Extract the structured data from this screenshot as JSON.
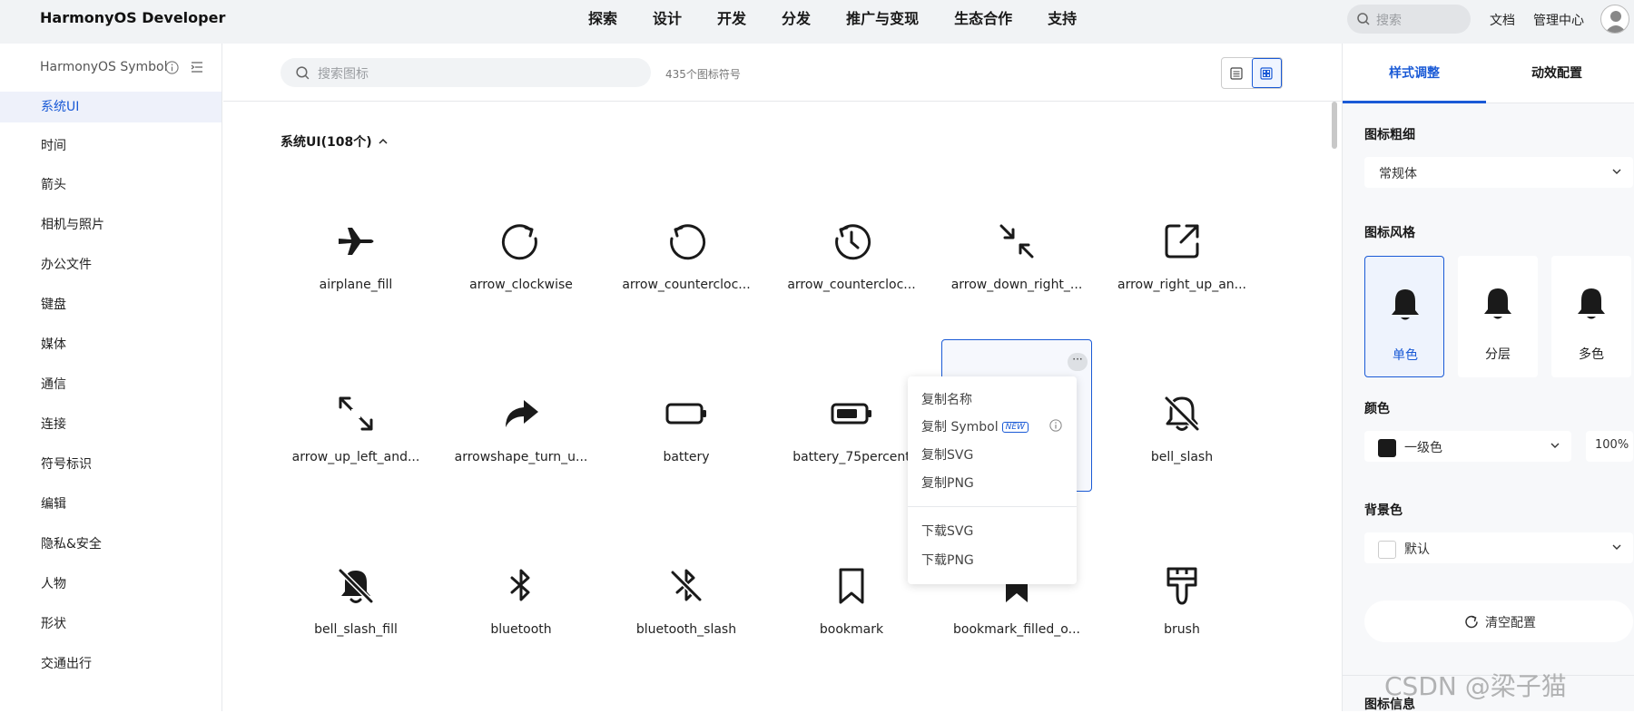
{
  "topbar": {
    "logo": "HarmonyOS Developer",
    "nav": [
      "探索",
      "设计",
      "开发",
      "分发",
      "推广与变现",
      "生态合作",
      "支持"
    ],
    "search_placeholder": "搜索",
    "docs_link": "文档",
    "admin_link": "管理中心"
  },
  "sidebar": {
    "title": "HarmonyOS Symbol",
    "items": [
      "系统UI",
      "时间",
      "箭头",
      "相机与照片",
      "办公文件",
      "键盘",
      "媒体",
      "通信",
      "连接",
      "符号标识",
      "编辑",
      "隐私&安全",
      "人物",
      "形状",
      "交通出行"
    ],
    "active_index": 0
  },
  "main": {
    "search_placeholder": "搜索图标",
    "count_text": "435个图标符号",
    "category_header": "系统UI(108个)",
    "icons": [
      "airplane_fill",
      "arrow_clockwise",
      "arrow_countercloc...",
      "arrow_countercloc...",
      "arrow_down_right_...",
      "arrow_right_up_an...",
      "arrow_up_left_and...",
      "arrowshape_turn_u...",
      "battery",
      "battery_75percent",
      "",
      "bell_slash",
      "bell_slash_fill",
      "bluetooth",
      "bluetooth_slash",
      "bookmark",
      "bookmark_filled_o...",
      "brush"
    ],
    "icon_names": [
      "airplane-icon",
      "arrow-clockwise-icon",
      "arrow-counterclockwise-icon",
      "clock-counterclockwise-icon",
      "arrow-down-right-icon",
      "arrow-right-up-icon",
      "arrow-up-left-icon",
      "arrowshape-turn-up-icon",
      "battery-icon",
      "battery-75-icon",
      "bell-icon",
      "bell-slash-icon",
      "bell-slash-fill-icon",
      "bluetooth-icon",
      "bluetooth-slash-icon",
      "bookmark-icon",
      "bookmark-filled-icon",
      "brush-icon"
    ],
    "hover_index": 10,
    "more_label": "···"
  },
  "context_menu": {
    "copy_name": "复制名称",
    "copy_symbol": "复制 Symbol",
    "new_badge": "NEW",
    "copy_svg": "复制SVG",
    "copy_png": "复制PNG",
    "download_svg": "下载SVG",
    "download_png": "下载PNG"
  },
  "right_panel": {
    "tab_style": "样式调整",
    "tab_motion": "动效配置",
    "weight_label": "图标粗细",
    "weight_value": "常规体",
    "style_label": "图标风格",
    "styles": [
      "单色",
      "分层",
      "多色"
    ],
    "color_label": "颜色",
    "color_value": "一级色",
    "color_swatch": "#1a1a1a",
    "opacity": "100%",
    "bg_label": "背景色",
    "bg_value": "默认",
    "clear_button": "清空配置",
    "info_label": "图标信息",
    "accent": "#1a5ad6"
  },
  "watermark": "CSDN @梁子猫"
}
